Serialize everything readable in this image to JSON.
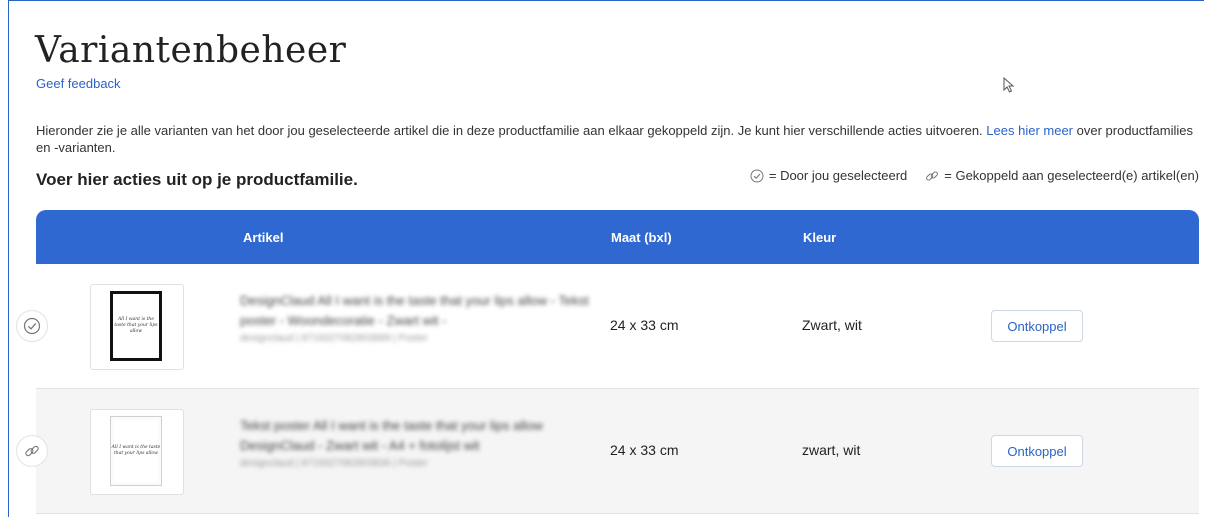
{
  "header": {
    "title": "Variantenbeheer",
    "feedback_link": "Geef feedback"
  },
  "intro": {
    "text": "Hieronder zie je alle varianten van het door jou geselecteerde artikel die in deze productfamilie aan elkaar gekoppeld zijn. Je kunt hier verschillende acties uitvoeren.",
    "link": "Lees hier meer",
    "tail": "over productfamilies en -varianten."
  },
  "subtitle": "Voer hier acties uit op je productfamilie.",
  "legend": {
    "selected": "= Door jou geselecteerd",
    "linked": "= Gekoppeld aan geselecteerd(e) artikel(en)"
  },
  "table": {
    "headers": {
      "artikel": "Artikel",
      "maat": "Maat (bxl)",
      "kleur": "Kleur"
    },
    "rows": [
      {
        "status_icon": "check-circle-icon",
        "title": "DesignClaud All I want is the taste that your lips allow - Tekst poster - Woondecoratie - Zwart wit -",
        "meta": "designclaud | 8719327082803899 | Poster",
        "size": "24 x 33 cm",
        "color": "Zwart, wit",
        "action": "Ontkoppel",
        "poster_frame": "black"
      },
      {
        "status_icon": "link-icon",
        "title": "Tekst poster All I want is the taste that your lips allow DesignClaud - Zwart wit - A4 + fotolijst wit",
        "meta": "designclaud | 8719327082803836 | Poster",
        "size": "24 x 33 cm",
        "color": "zwart, wit",
        "action": "Ontkoppel",
        "poster_frame": "white"
      }
    ],
    "poster_script": "All I want is the taste that your lips allow"
  },
  "colors": {
    "accent": "#2f68d1",
    "link": "#2c63c7"
  }
}
